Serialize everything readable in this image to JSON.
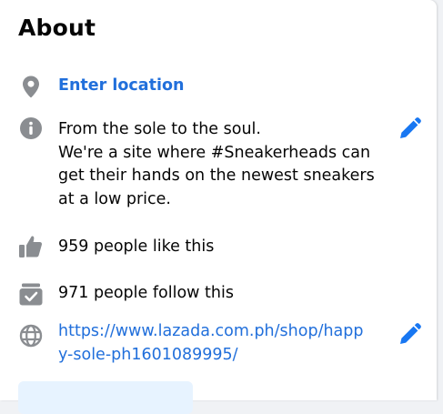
{
  "about": {
    "title": "About",
    "location": "Enter location",
    "description": [
      "From the sole to the soul.",
      "We're a site where #Sneakerheads can",
      "get their hands on the newest sneakers",
      "at a low price."
    ],
    "likes": "959 people like this",
    "follows": "971 people follow this",
    "website": [
      "https://www.lazada.com.ph/shop/happ",
      "y-sole-ph1601089995/"
    ]
  },
  "icons": {
    "location": "map-pin-icon",
    "info": "info-icon",
    "likes": "thumbs-up-icon",
    "follows": "follow-box-icon",
    "website": "globe-icon",
    "edit": "pencil-icon"
  },
  "colors": {
    "link": "#216fdb",
    "icon_gray": "#8a8d91",
    "edit_blue": "#1877f2",
    "text": "#050505"
  }
}
